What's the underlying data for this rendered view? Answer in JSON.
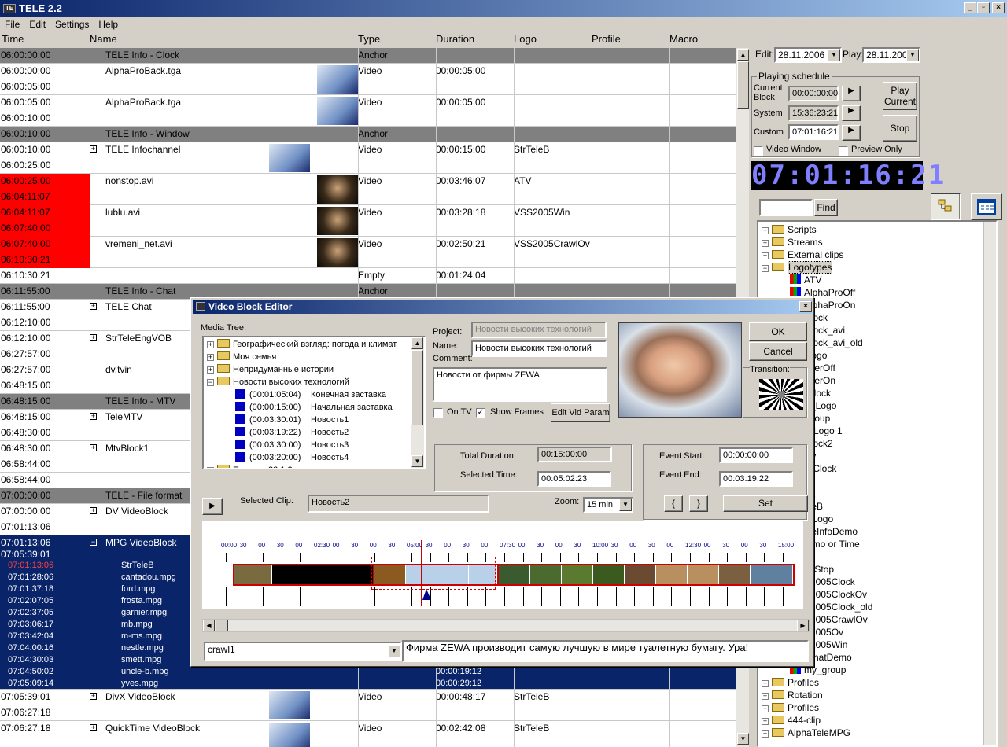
{
  "window": {
    "title": "TELE 2.2",
    "icon_text": "TE",
    "min": "_",
    "max": "▫",
    "close": "×"
  },
  "menu": [
    "File",
    "Edit",
    "Settings",
    "Help"
  ],
  "columns": {
    "time": "Time",
    "name": "Name",
    "type": "Type",
    "duration": "Duration",
    "logo": "Logo",
    "profile": "Profile",
    "macro": "Macro"
  },
  "rows": [
    {
      "t1": "06:00:00:00",
      "name": "TELE Info - Clock",
      "type": "Anchor",
      "kind": "anchor"
    },
    {
      "t1": "06:00:00:00",
      "t2": "06:00:05:00",
      "name": "AlphaProBack.tga",
      "type": "Video",
      "dur": "00:00:05:00",
      "thumb": "blue"
    },
    {
      "t1": "06:00:05:00",
      "t2": "06:00:10:00",
      "name": "AlphaProBack.tga",
      "type": "Video",
      "dur": "00:00:05:00",
      "thumb": "blue"
    },
    {
      "t1": "06:00:10:00",
      "name": "TELE Info - Window",
      "type": "Anchor",
      "kind": "anchor"
    },
    {
      "t1": "06:00:10:00",
      "t2": "06:00:25:00",
      "name": "TELE Infochannel",
      "type": "Video",
      "dur": "00:00:15:00",
      "logo": "StrTeleB",
      "thumb": "blue2",
      "plus": "+"
    },
    {
      "t1": "06:00:25:00",
      "t2": "06:04:11:07",
      "name": "nonstop.avi",
      "type": "Video",
      "dur": "00:03:46:07",
      "logo": "ATV",
      "thumb": "dark",
      "kind": "red"
    },
    {
      "t1": "06:04:11:07",
      "t2": "06:07:40:00",
      "name": "lublu.avi",
      "type": "Video",
      "dur": "00:03:28:18",
      "logo": "VSS2005Win",
      "thumb": "dark",
      "kind": "red"
    },
    {
      "t1": "06:07:40:00",
      "t2": "06:10:30:21",
      "name": "vremeni_net.avi",
      "type": "Video",
      "dur": "00:02:50:21",
      "logo": "VSS2005CrawlOv",
      "thumb": "dark",
      "kind": "red"
    },
    {
      "t1": "06:10:30:21",
      "name": "",
      "type": "Empty",
      "dur": "00:01:24:04",
      "kind": "single"
    },
    {
      "t1": "06:11:55:00",
      "name": "TELE Info - Chat",
      "type": "Anchor",
      "kind": "anchor"
    },
    {
      "t1": "06:11:55:00",
      "t2": "06:12:10:00",
      "name": "TELE Chat",
      "plus": "+"
    },
    {
      "t1": "06:12:10:00",
      "t2": "06:27:57:00",
      "name": "StrTeleEngVOB",
      "plus": "+"
    },
    {
      "t1": "06:27:57:00",
      "t2": "06:48:15:00",
      "name": "dv.tvin"
    },
    {
      "t1": "06:48:15:00",
      "name": "TELE Info - MTV",
      "type": "Anchor",
      "kind": "anchor"
    },
    {
      "t1": "06:48:15:00",
      "t2": "06:48:30:00",
      "name": "TeleMTV",
      "plus": "+"
    },
    {
      "t1": "06:48:30:00",
      "t2": "06:58:44:00",
      "name": "MtvBlock1",
      "plus": "+"
    },
    {
      "t1": "06:58:44:00",
      "name": "",
      "kind": "single"
    },
    {
      "t1": "07:00:00:00",
      "name": "TELE - File format",
      "kind": "anchor"
    },
    {
      "t1": "07:00:00:00",
      "t2": "07:01:13:06",
      "name": "DV VideoBlock",
      "plus": "+"
    }
  ],
  "selected_block": {
    "t1": "07:01:13:06",
    "t2": "07:05:39:01",
    "name": "MPG VideoBlock",
    "minus": "−",
    "sub": [
      {
        "t": "07:01:13:06",
        "n": "StrTeleB",
        "red": true
      },
      {
        "t": "07:01:28:06",
        "n": "cantadou.mpg"
      },
      {
        "t": "07:01:37:18",
        "n": "ford.mpg"
      },
      {
        "t": "07:02:07:05",
        "n": "frosta.mpg"
      },
      {
        "t": "07:02:37:05",
        "n": "garnier.mpg"
      },
      {
        "t": "07:03:06:17",
        "n": "mb.mpg"
      },
      {
        "t": "07:03:42:04",
        "n": "m-ms.mpg"
      },
      {
        "t": "07:04:00:16",
        "n": "nestle.mpg"
      },
      {
        "t": "07:04:30:03",
        "n": "smett.mpg"
      },
      {
        "t": "07:04:50:02",
        "n": "uncle-b.mpg",
        "dur": "00:00:19:12"
      },
      {
        "t": "07:05:09:14",
        "n": "yves.mpg",
        "dur": "00:00:29:12"
      }
    ]
  },
  "bottom_rows": [
    {
      "t1": "07:05:39:01",
      "t2": "07:06:27:18",
      "name": "DivX VideoBlock",
      "type": "Video",
      "dur": "00:00:48:17",
      "logo": "StrTeleB",
      "plus": "+"
    },
    {
      "t1": "07:06:27:18",
      "name": "QuickTime VideoBlock",
      "type": "Video",
      "dur": "00:02:42:08",
      "logo": "StrTeleB",
      "plus": "+"
    }
  ],
  "right": {
    "edit_label": "Edit:",
    "edit_date": "28.11.2006",
    "play_label": "Play:",
    "play_date": "28.11.2006",
    "schedule_title": "Playing schedule",
    "current_block_label": "Current Block",
    "current_block": "00:00:00:00",
    "system_label": "System",
    "system": "15:36:23:21",
    "custom_label": "Custom",
    "custom": "07:01:16:21",
    "play_current": "Play Current",
    "stop": "Stop",
    "video_window": "Video Window",
    "preview_only": "Preview Only",
    "clock": "07:01:16:21",
    "find": "Find"
  },
  "tree": [
    {
      "label": "Scripts",
      "type": "folder",
      "exp": "+"
    },
    {
      "label": "Streams",
      "type": "folder",
      "exp": "+"
    },
    {
      "label": "External clips",
      "type": "folder",
      "exp": "+"
    },
    {
      "label": "Logotypes",
      "type": "folder",
      "exp": "−",
      "sel": true
    },
    {
      "label": "ATV",
      "type": "logo"
    },
    {
      "label": "AlphaProOff",
      "type": "logo"
    },
    {
      "label": "AlphaProOn",
      "type": "logo"
    },
    {
      "label": "Clock",
      "type": "logo"
    },
    {
      "label": "Clock_avi",
      "type": "logo"
    },
    {
      "label": "Clock_avi_old",
      "type": "logo"
    },
    {
      "label": "_logo",
      "type": "logo"
    },
    {
      "label": "nnerOff",
      "type": "logo"
    },
    {
      "label": "nnerOn",
      "type": "logo"
    },
    {
      "label": "-Clock",
      "type": "logo"
    },
    {
      "label": "V_Logo",
      "type": "logo"
    },
    {
      "label": "Group",
      "type": "logo"
    },
    {
      "label": "w Logo 1",
      "type": "logo"
    },
    {
      "label": "Clock2",
      "type": "logo"
    },
    {
      "label": "Ov",
      "type": "logo"
    },
    {
      "label": "V-Clock",
      "type": "logo"
    },
    {
      "label": "S",
      "type": "logo"
    },
    {
      "label": "S1",
      "type": "logo"
    },
    {
      "label": "eleB",
      "type": "logo"
    },
    {
      "label": "T Logo",
      "type": "logo"
    },
    {
      "label": "eleInfoDemo",
      "type": "logo"
    },
    {
      "label": "ermo or Time",
      "type": "logo"
    },
    {
      "label": "e",
      "type": "logo"
    },
    {
      "label": "e_Stop",
      "type": "logo"
    },
    {
      "label": "S2005Clock",
      "type": "logo"
    },
    {
      "label": "S2005ClockOv",
      "type": "logo"
    },
    {
      "label": "S2005Clock_old",
      "type": "logo"
    },
    {
      "label": "S2005CrawlOv",
      "type": "logo"
    },
    {
      "label": "S2005Ov",
      "type": "logo"
    },
    {
      "label": "S2005Win",
      "type": "logo"
    },
    {
      "label": "vchatDemo",
      "type": "logo"
    },
    {
      "label": "my_group",
      "type": "logo"
    },
    {
      "label": "Profiles",
      "type": "folder",
      "exp": "+"
    },
    {
      "label": "Rotation",
      "type": "folder",
      "exp": "+"
    },
    {
      "label": "Profiles",
      "type": "folder",
      "exp": "+"
    },
    {
      "label": "444-clip",
      "type": "folder",
      "exp": "+"
    },
    {
      "label": "AlphaTeleMPG",
      "type": "folder",
      "exp": "+"
    }
  ],
  "dialog": {
    "title": "Video Block Editor",
    "media_tree": "Media Tree:",
    "media_items": [
      {
        "l": "Географический взгляд: погода и климат",
        "folder": true,
        "exp": "+"
      },
      {
        "l": "Моя семья",
        "folder": true,
        "exp": "+"
      },
      {
        "l": "Непридуманные истории",
        "folder": true,
        "exp": "+"
      },
      {
        "l": "Новости высоких технологий",
        "folder": true,
        "exp": "−"
      },
      {
        "l": "(00:01:05:04)",
        "d": "Конечная заставка"
      },
      {
        "l": "(00:00:15:00)",
        "d": "Начальная заставка"
      },
      {
        "l": "(00:03:30:01)",
        "d": "Новость1"
      },
      {
        "l": "(00:03:19:22)",
        "d": "Новость2"
      },
      {
        "l": "(00:03:30:00)",
        "d": "Новость3"
      },
      {
        "l": "(00:03:20:00)",
        "d": "Новость4"
      },
      {
        "l": "По всем 22.1.2",
        "folder": true,
        "exp": "+"
      }
    ],
    "project_label": "Project:",
    "project": "Новости высоких технологий",
    "name_label": "Name:",
    "name": "Новости высоких технологий",
    "comment_label": "Comment:",
    "comment": "Новости от фирмы ZEWA",
    "on_tv": "On TV",
    "show_frames": "Show Frames",
    "edit_vid": "Edit Vid Param",
    "ok": "OK",
    "cancel": "Cancel",
    "transition": "Transition:",
    "total_label": "Total Duration",
    "total": "00:15:00:00",
    "selected_time_label": "Selected Time:",
    "selected_time": "00:05:02:23",
    "event_start_label": "Event Start:",
    "event_start": "00:00:00:00",
    "event_end_label": "Event End:",
    "event_end": "00:03:19:22",
    "brace_open": "{",
    "brace_close": "}",
    "set": "Set",
    "selected_clip_label": "Selected Clip:",
    "selected_clip": "Новость2",
    "zoom_label": "Zoom:",
    "zoom": "15 min",
    "crawl_select": "crawl1",
    "crawl_text": "Фирма ZEWA производит самую лучшую в мире туалетную бумагу. Ура!",
    "timeline_labels": [
      "00:00",
      "30",
      "00",
      "30",
      "00",
      "02:30",
      "00",
      "30",
      "00",
      "30",
      "05:00",
      "30",
      "00",
      "30",
      "00",
      "07:30",
      "00",
      "30",
      "00",
      "30",
      "10:00",
      "30",
      "00",
      "30",
      "00",
      "12:30",
      "00",
      "30",
      "00",
      "30",
      "15:00"
    ]
  }
}
